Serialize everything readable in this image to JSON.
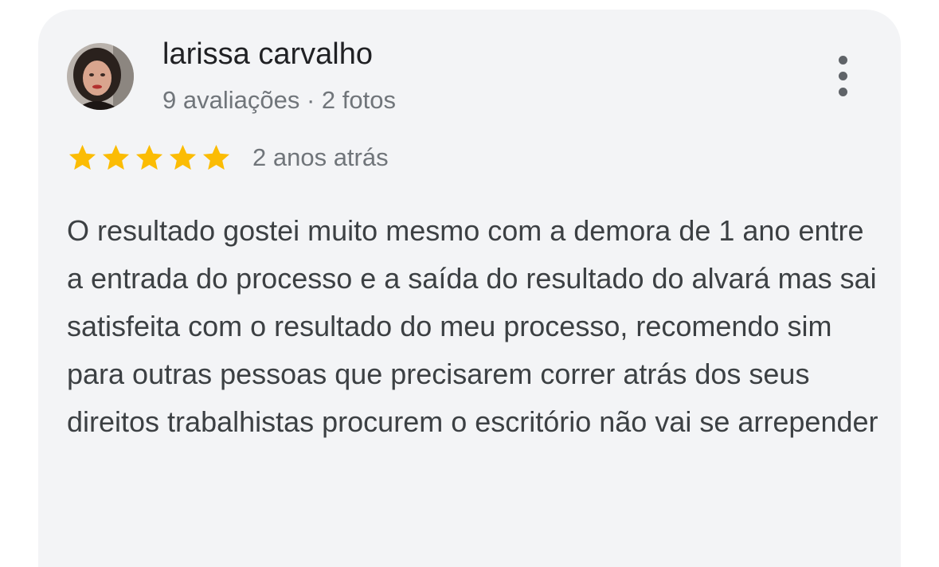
{
  "review": {
    "author": {
      "name": "larissa carvalho",
      "meta": "9 avaliações · 2 fotos"
    },
    "rating": {
      "value": 5,
      "max": 5,
      "star_color": "#fbbc04"
    },
    "date": "2 anos atrás",
    "text": "O resultado gostei muito mesmo com a demora de 1 ano entre a entrada do processo e a saída do resultado do alvará mas sai satisfeita com o resultado do meu processo, recomendo sim para outras pessoas que precisarem correr atrás dos seus direitos trabalhistas procurem o escritório não vai se arrepender"
  },
  "icons": {
    "more": "more-vert-icon",
    "star": "star-icon"
  }
}
